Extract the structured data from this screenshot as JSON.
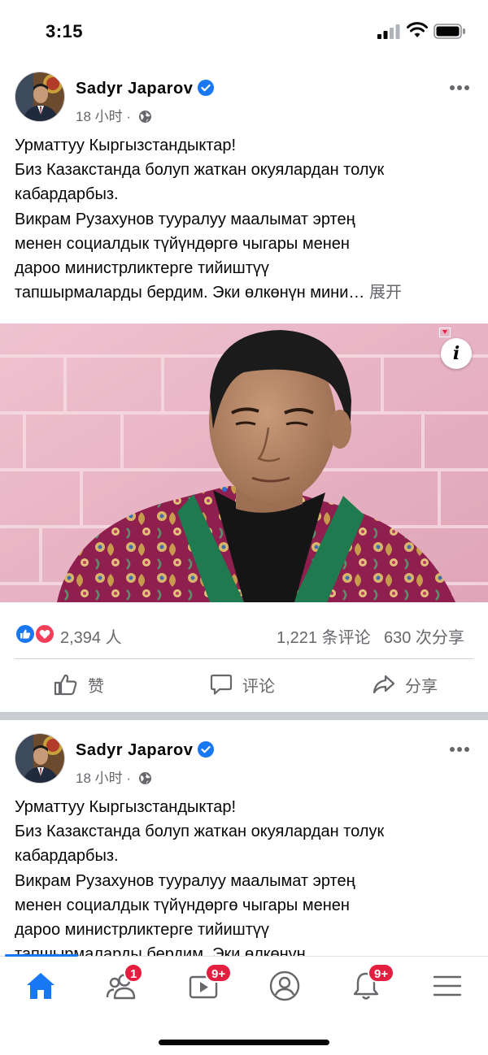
{
  "status_bar": {
    "time": "3:15"
  },
  "posts": [
    {
      "author": "Sadyr  Japarov",
      "time": "18 小时",
      "lines": [
        "Урматтуу Кыргызстандыктар!",
        "Биз Казакстанда болуп жаткан окуялардан толук",
        "кабардарбыз.",
        "Викрам Рузахунов тууралуу маалымат эртең",
        "менен социалдык түйүндөргө чыгары менен",
        "дароо министрликтерге тийиштүү",
        "тапшырмаларды бердим. Эки өлкөнүн мини…"
      ],
      "see_more": "展开",
      "reaction_count": "2,394 人",
      "comments": "1,221 条评论",
      "shares": "630 次分享",
      "actions": {
        "like": "赞",
        "comment": "评论",
        "share": "分享"
      }
    },
    {
      "author": "Sadyr  Japarov",
      "time": "18 小时",
      "lines": [
        "Урматтуу Кыргызстандыктар!",
        "Биз Казакстанда болуп жаткан окуялардан толук",
        "кабардарбыз.",
        "Викрам Рузахунов тууралуу маалымат эртең",
        "менен социалдык түйүндөргө чыгары менен",
        "дароо министрликтерге тийиштүү",
        "тапшырмаларды бердим. Эки өлкөнүн"
      ]
    }
  ],
  "bottom_nav": {
    "friends_badge": "1",
    "watch_badge": "9+",
    "notifications_badge": "9+"
  },
  "colors": {
    "accent": "#1877f2",
    "badge": "#e41e3f",
    "secondary_text": "#65676b"
  },
  "icons": [
    "signal-icon",
    "wifi-icon",
    "battery-icon",
    "verified-icon",
    "globe-icon",
    "more-icon",
    "info-icon",
    "like-reaction-icon",
    "love-reaction-icon",
    "thumbs-up-icon",
    "comment-icon",
    "share-icon",
    "home-icon",
    "friends-icon",
    "watch-icon",
    "profile-icon",
    "bell-icon",
    "menu-icon"
  ]
}
